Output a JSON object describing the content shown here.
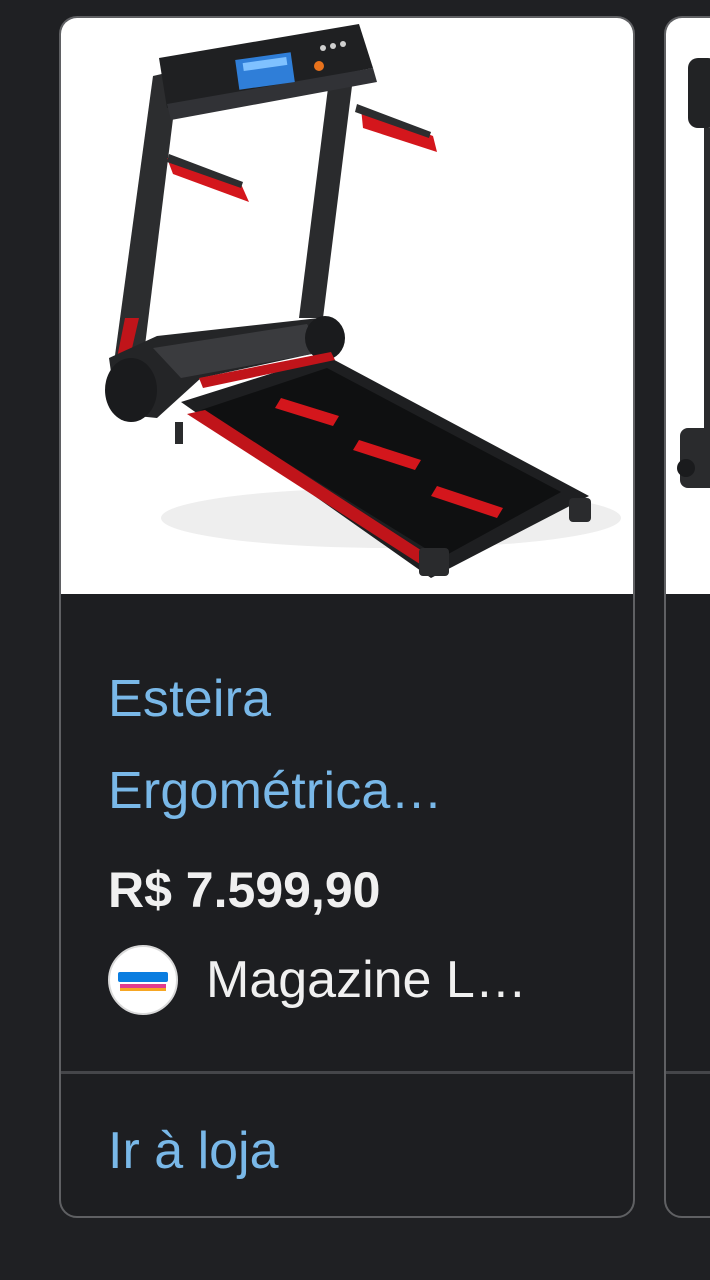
{
  "product": {
    "title_line1": "Esteira",
    "title_line2": "Ergométrica…",
    "price": "R$ 7.599,90",
    "seller": "Magazine L…",
    "seller_logo_icon": "magazine-luiza-logo-icon",
    "cta_label": "Ir à loja",
    "image_icon": "treadmill-image"
  },
  "colors": {
    "background": "#1f2023",
    "card_border": "#5f6063",
    "link_blue": "#79b8e8",
    "text_white": "#f0f0f0",
    "accent_red": "#d4161c"
  }
}
